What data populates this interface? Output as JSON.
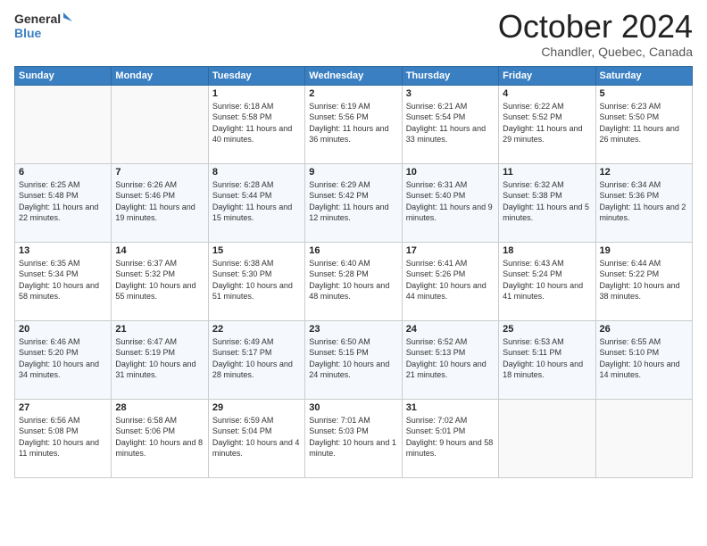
{
  "header": {
    "logo_line1": "General",
    "logo_line2": "Blue",
    "title": "October 2024",
    "location": "Chandler, Quebec, Canada"
  },
  "days_of_week": [
    "Sunday",
    "Monday",
    "Tuesday",
    "Wednesday",
    "Thursday",
    "Friday",
    "Saturday"
  ],
  "weeks": [
    [
      {
        "day": "",
        "info": ""
      },
      {
        "day": "",
        "info": ""
      },
      {
        "day": "1",
        "info": "Sunrise: 6:18 AM\nSunset: 5:58 PM\nDaylight: 11 hours and 40 minutes."
      },
      {
        "day": "2",
        "info": "Sunrise: 6:19 AM\nSunset: 5:56 PM\nDaylight: 11 hours and 36 minutes."
      },
      {
        "day": "3",
        "info": "Sunrise: 6:21 AM\nSunset: 5:54 PM\nDaylight: 11 hours and 33 minutes."
      },
      {
        "day": "4",
        "info": "Sunrise: 6:22 AM\nSunset: 5:52 PM\nDaylight: 11 hours and 29 minutes."
      },
      {
        "day": "5",
        "info": "Sunrise: 6:23 AM\nSunset: 5:50 PM\nDaylight: 11 hours and 26 minutes."
      }
    ],
    [
      {
        "day": "6",
        "info": "Sunrise: 6:25 AM\nSunset: 5:48 PM\nDaylight: 11 hours and 22 minutes."
      },
      {
        "day": "7",
        "info": "Sunrise: 6:26 AM\nSunset: 5:46 PM\nDaylight: 11 hours and 19 minutes."
      },
      {
        "day": "8",
        "info": "Sunrise: 6:28 AM\nSunset: 5:44 PM\nDaylight: 11 hours and 15 minutes."
      },
      {
        "day": "9",
        "info": "Sunrise: 6:29 AM\nSunset: 5:42 PM\nDaylight: 11 hours and 12 minutes."
      },
      {
        "day": "10",
        "info": "Sunrise: 6:31 AM\nSunset: 5:40 PM\nDaylight: 11 hours and 9 minutes."
      },
      {
        "day": "11",
        "info": "Sunrise: 6:32 AM\nSunset: 5:38 PM\nDaylight: 11 hours and 5 minutes."
      },
      {
        "day": "12",
        "info": "Sunrise: 6:34 AM\nSunset: 5:36 PM\nDaylight: 11 hours and 2 minutes."
      }
    ],
    [
      {
        "day": "13",
        "info": "Sunrise: 6:35 AM\nSunset: 5:34 PM\nDaylight: 10 hours and 58 minutes."
      },
      {
        "day": "14",
        "info": "Sunrise: 6:37 AM\nSunset: 5:32 PM\nDaylight: 10 hours and 55 minutes."
      },
      {
        "day": "15",
        "info": "Sunrise: 6:38 AM\nSunset: 5:30 PM\nDaylight: 10 hours and 51 minutes."
      },
      {
        "day": "16",
        "info": "Sunrise: 6:40 AM\nSunset: 5:28 PM\nDaylight: 10 hours and 48 minutes."
      },
      {
        "day": "17",
        "info": "Sunrise: 6:41 AM\nSunset: 5:26 PM\nDaylight: 10 hours and 44 minutes."
      },
      {
        "day": "18",
        "info": "Sunrise: 6:43 AM\nSunset: 5:24 PM\nDaylight: 10 hours and 41 minutes."
      },
      {
        "day": "19",
        "info": "Sunrise: 6:44 AM\nSunset: 5:22 PM\nDaylight: 10 hours and 38 minutes."
      }
    ],
    [
      {
        "day": "20",
        "info": "Sunrise: 6:46 AM\nSunset: 5:20 PM\nDaylight: 10 hours and 34 minutes."
      },
      {
        "day": "21",
        "info": "Sunrise: 6:47 AM\nSunset: 5:19 PM\nDaylight: 10 hours and 31 minutes."
      },
      {
        "day": "22",
        "info": "Sunrise: 6:49 AM\nSunset: 5:17 PM\nDaylight: 10 hours and 28 minutes."
      },
      {
        "day": "23",
        "info": "Sunrise: 6:50 AM\nSunset: 5:15 PM\nDaylight: 10 hours and 24 minutes."
      },
      {
        "day": "24",
        "info": "Sunrise: 6:52 AM\nSunset: 5:13 PM\nDaylight: 10 hours and 21 minutes."
      },
      {
        "day": "25",
        "info": "Sunrise: 6:53 AM\nSunset: 5:11 PM\nDaylight: 10 hours and 18 minutes."
      },
      {
        "day": "26",
        "info": "Sunrise: 6:55 AM\nSunset: 5:10 PM\nDaylight: 10 hours and 14 minutes."
      }
    ],
    [
      {
        "day": "27",
        "info": "Sunrise: 6:56 AM\nSunset: 5:08 PM\nDaylight: 10 hours and 11 minutes."
      },
      {
        "day": "28",
        "info": "Sunrise: 6:58 AM\nSunset: 5:06 PM\nDaylight: 10 hours and 8 minutes."
      },
      {
        "day": "29",
        "info": "Sunrise: 6:59 AM\nSunset: 5:04 PM\nDaylight: 10 hours and 4 minutes."
      },
      {
        "day": "30",
        "info": "Sunrise: 7:01 AM\nSunset: 5:03 PM\nDaylight: 10 hours and 1 minute."
      },
      {
        "day": "31",
        "info": "Sunrise: 7:02 AM\nSunset: 5:01 PM\nDaylight: 9 hours and 58 minutes."
      },
      {
        "day": "",
        "info": ""
      },
      {
        "day": "",
        "info": ""
      }
    ]
  ]
}
